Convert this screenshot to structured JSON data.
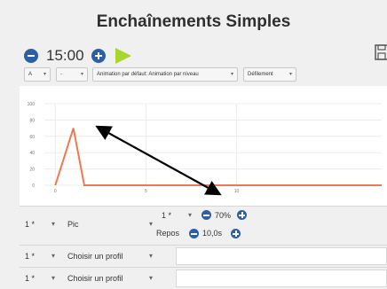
{
  "title": "Enchaînements Simples",
  "timer": {
    "value": "15:00"
  },
  "toolbar": {
    "combo1": "A",
    "combo2": "-",
    "animation": "Animation par défaut: Animation par niveau",
    "scroll": "Défilement"
  },
  "chart_data": {
    "type": "line",
    "x": [
      0,
      1,
      1.6,
      18
    ],
    "values": [
      0,
      70,
      0,
      0
    ],
    "yticks": [
      "0",
      "20",
      "40",
      "60",
      "80",
      "100"
    ],
    "xticks": [
      "0",
      "5",
      "10"
    ],
    "ylim": [
      0,
      100
    ],
    "xlim": [
      -0.6,
      18
    ],
    "grid": true,
    "line_color": "#f07850"
  },
  "rows": [
    {
      "count": "1 *",
      "profile": "Pic",
      "sub_count": "1 *",
      "percent": "70%",
      "repos_label": "Repos",
      "repos_value": "10,0s"
    },
    {
      "count": "1 *",
      "profile": "Choisir un profil"
    },
    {
      "count": "1 *",
      "profile": "Choisir un profil"
    }
  ],
  "colors": {
    "accent": "#2e5ea5",
    "play": "#a8d62c",
    "line": "#f07850"
  }
}
